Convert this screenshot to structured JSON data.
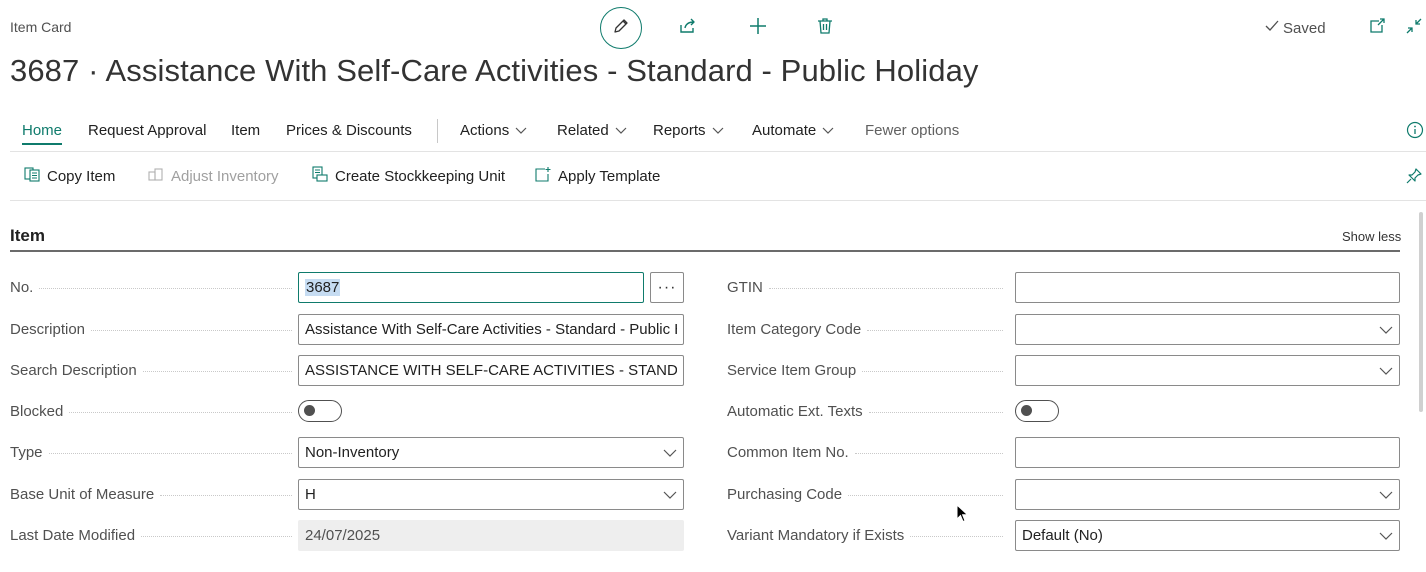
{
  "header": {
    "page_type": "Item Card",
    "title": "3687 · Assistance With Self-Care Activities - Standard - Public Holiday",
    "saved_label": "Saved",
    "toolbar_icons": [
      "edit-pencil-icon",
      "share-icon",
      "plus-icon",
      "delete-trash-icon"
    ],
    "window_icons": [
      "open-new-window-icon",
      "collapse-icon"
    ]
  },
  "menu": {
    "items": [
      "Home",
      "Request Approval",
      "Item",
      "Prices & Discounts"
    ],
    "dropdowns": [
      "Actions",
      "Related",
      "Reports",
      "Automate"
    ],
    "fewer_options": "Fewer options",
    "active": "Home"
  },
  "home_actions": [
    {
      "label": "Copy Item",
      "icon": "copy-icon",
      "enabled": true
    },
    {
      "label": "Adjust Inventory",
      "icon": "adjust-inventory-icon",
      "enabled": false
    },
    {
      "label": "Create Stockkeeping Unit",
      "icon": "stockkeeping-icon",
      "enabled": true
    },
    {
      "label": "Apply Template",
      "icon": "template-icon",
      "enabled": true
    }
  ],
  "section": {
    "title": "Item",
    "show_less": "Show less"
  },
  "left_fields": [
    {
      "label": "No.",
      "value": "3687",
      "kind": "text-lookup"
    },
    {
      "label": "Description",
      "value": "Assistance With Self-Care Activities - Standard - Public Holiday",
      "kind": "text"
    },
    {
      "label": "Search Description",
      "value": "ASSISTANCE WITH SELF-CARE ACTIVITIES - STANDARD - PUBLIC HOLIDAY",
      "kind": "text"
    },
    {
      "label": "Blocked",
      "value": "off",
      "kind": "toggle"
    },
    {
      "label": "Type",
      "value": "Non-Inventory",
      "kind": "select"
    },
    {
      "label": "Base Unit of Measure",
      "value": "H",
      "kind": "select"
    },
    {
      "label": "Last Date Modified",
      "value": "24/07/2025",
      "kind": "readonly"
    }
  ],
  "right_fields": [
    {
      "label": "GTIN",
      "value": "",
      "kind": "text"
    },
    {
      "label": "Item Category Code",
      "value": "",
      "kind": "select"
    },
    {
      "label": "Service Item Group",
      "value": "",
      "kind": "select"
    },
    {
      "label": "Automatic Ext. Texts",
      "value": "off",
      "kind": "toggle"
    },
    {
      "label": "Common Item No.",
      "value": "",
      "kind": "text"
    },
    {
      "label": "Purchasing Code",
      "value": "",
      "kind": "select"
    },
    {
      "label": "Variant Mandatory if Exists",
      "value": "Default (No)",
      "kind": "select"
    }
  ],
  "colors": {
    "accent": "#0f7b6c",
    "label": "#505050",
    "border": "#8a8a8a",
    "selection": "#c6dcf2"
  }
}
